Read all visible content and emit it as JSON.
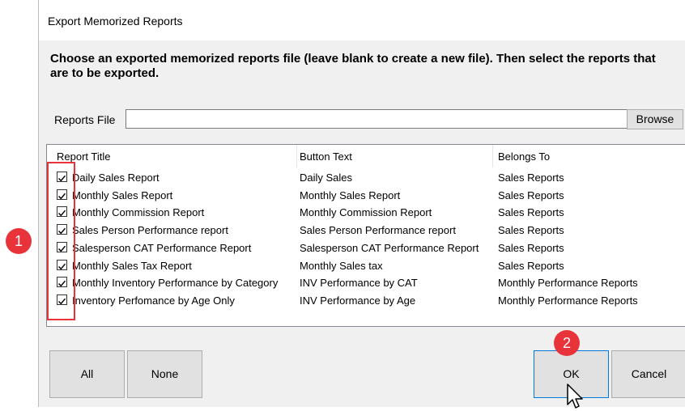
{
  "window": {
    "title": "Export Memorized Reports"
  },
  "instructions": "Choose an exported memorized reports file (leave blank to create a new file).  Then select the reports that are to be exported.",
  "reports_file": {
    "label": "Reports File",
    "value": "",
    "browse_label": "Browse"
  },
  "columns": [
    "Report Title",
    "Button Text",
    "Belongs To"
  ],
  "rows": [
    {
      "checked": true,
      "title": "Daily Sales Report",
      "button_text": "Daily Sales",
      "belongs_to": "Sales Reports"
    },
    {
      "checked": true,
      "title": "Monthly Sales Report",
      "button_text": "Monthly Sales Report",
      "belongs_to": "Sales Reports"
    },
    {
      "checked": true,
      "title": "Monthly Commission Report",
      "button_text": "Monthly Commission Report",
      "belongs_to": "Sales Reports"
    },
    {
      "checked": true,
      "title": "Sales Person Performance report",
      "button_text": "Sales Person Performance report",
      "belongs_to": "Sales Reports"
    },
    {
      "checked": true,
      "title": "Salesperson CAT Performance Report",
      "button_text": "Salesperson CAT Performance Report",
      "belongs_to": "Sales Reports"
    },
    {
      "checked": true,
      "title": "Monthly Sales Tax Report",
      "button_text": "Monthly Sales tax",
      "belongs_to": "Sales Reports"
    },
    {
      "checked": true,
      "title": "Monthly Inventory Performance by Category",
      "button_text": "INV Performance by CAT",
      "belongs_to": "Monthly Performance Reports"
    },
    {
      "checked": true,
      "title": "Inventory Perfomance by Age Only",
      "button_text": "INV Performance by Age",
      "belongs_to": "Monthly Performance Reports"
    }
  ],
  "buttons": {
    "all": "All",
    "none": "None",
    "ok": "OK",
    "cancel": "Cancel"
  },
  "annotations": {
    "step1": "1",
    "step2": "2",
    "accent": "#e8333a"
  }
}
